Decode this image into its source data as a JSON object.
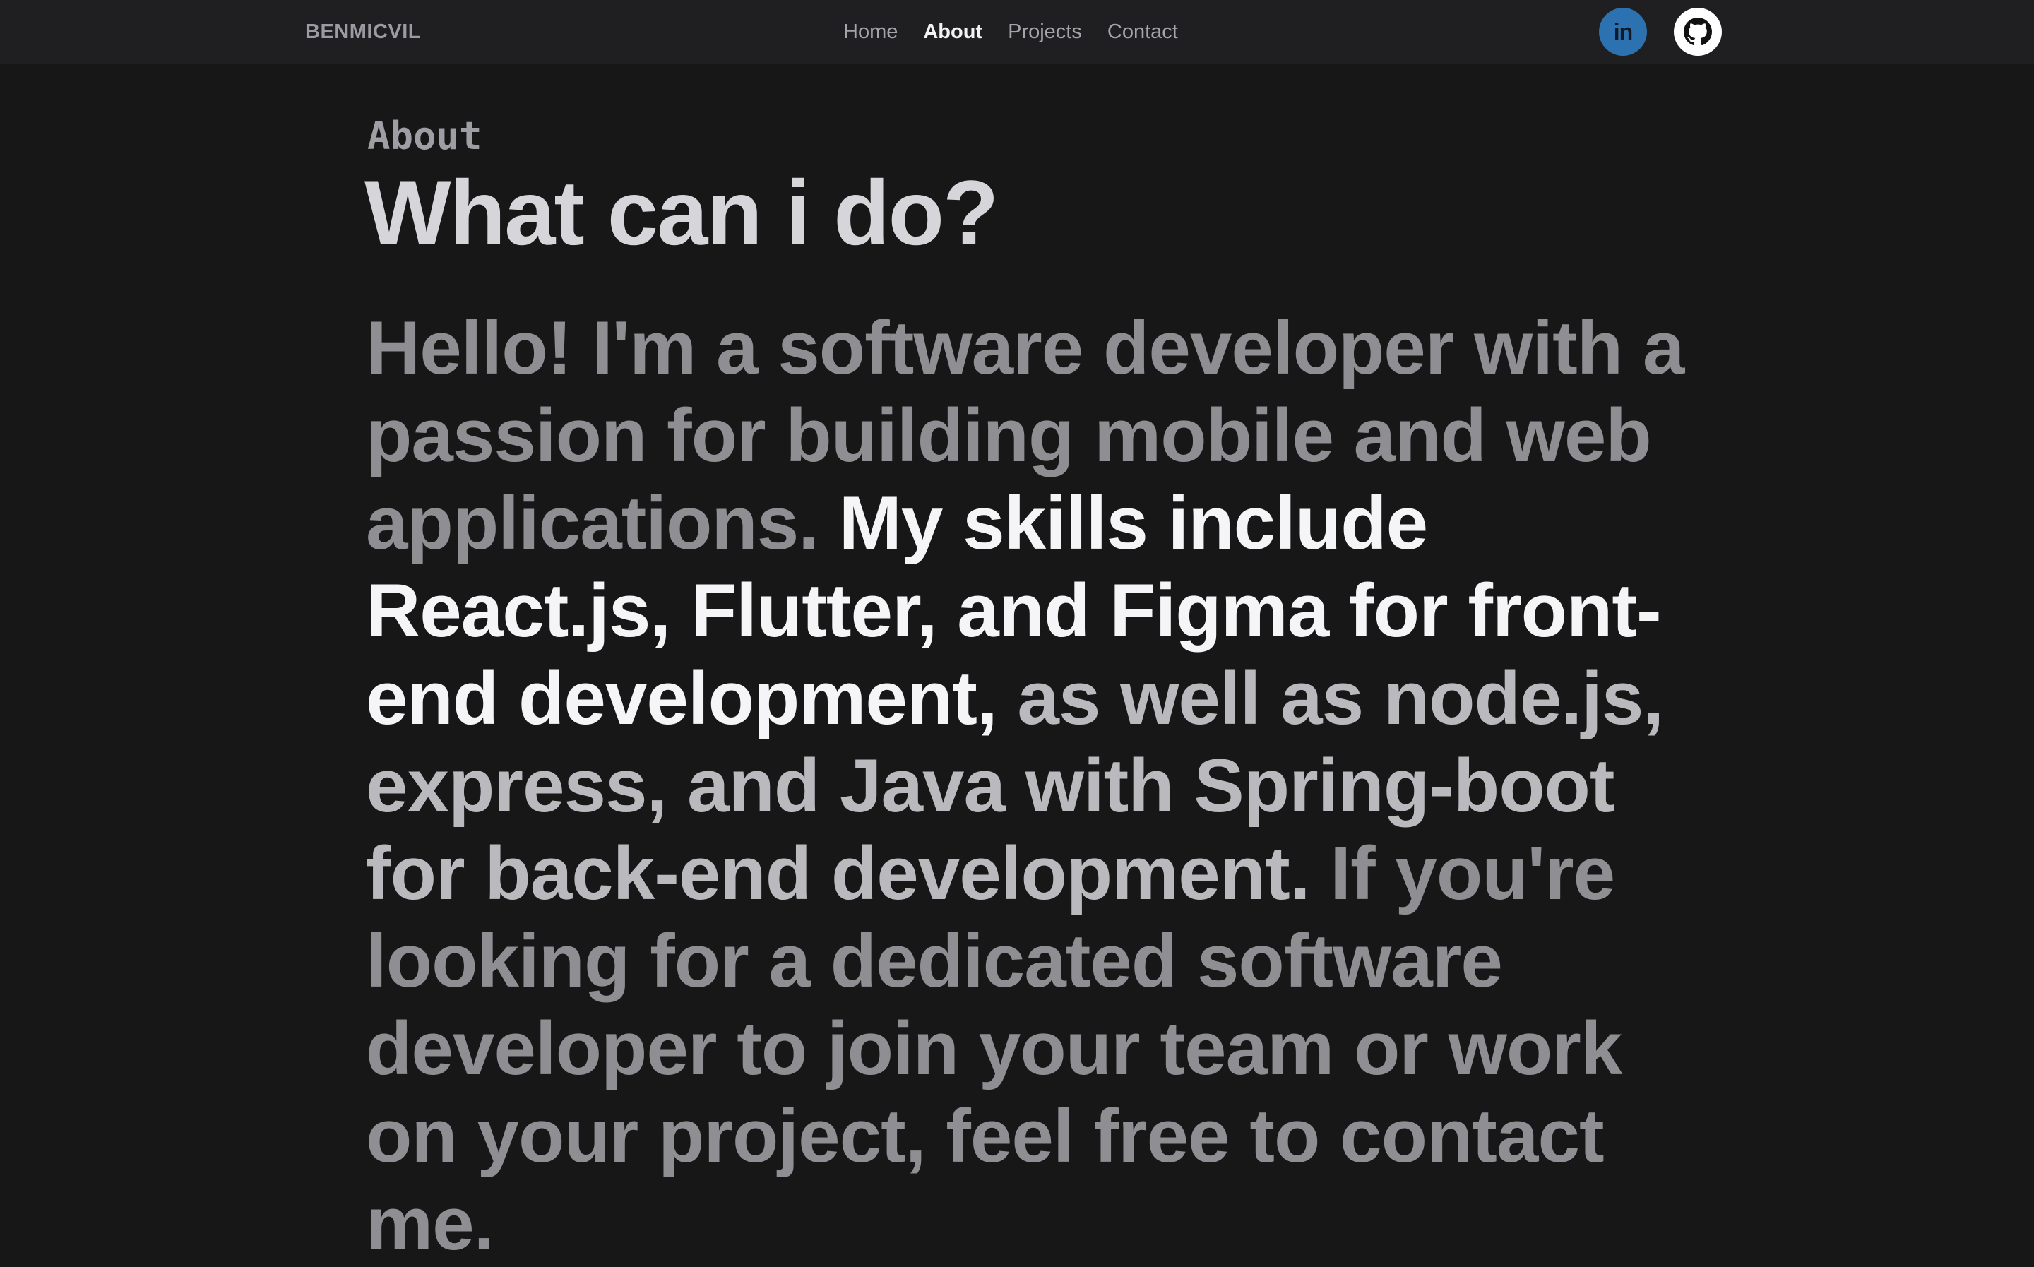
{
  "header": {
    "brand": "BENMICVIL",
    "nav": [
      {
        "label": "Home",
        "active": false
      },
      {
        "label": "About",
        "active": true
      },
      {
        "label": "Projects",
        "active": false
      },
      {
        "label": "Contact",
        "active": false
      }
    ],
    "social": [
      {
        "name": "linkedin-icon",
        "glyph": "in",
        "color": "#2c72b0"
      },
      {
        "name": "github-icon",
        "color": "#ffffff"
      }
    ]
  },
  "about": {
    "eyebrow": "About",
    "headline": "What can i do?",
    "bio": {
      "intro": "Hello! I'm a software developer with a passion for building mobile and web applications.",
      "frontend": "My skills include React.js, Flutter, and Figma for front-end development,",
      "backend_intro": "as well as node.js,",
      "backend": "express, and Java with Spring-boot for back-end development.",
      "outro": "If you're looking for a dedicated software developer to join your team or work on your project, feel free to contact me."
    }
  },
  "colors": {
    "background": "#171718",
    "header_background": "#1f1f21",
    "highlight": "#f5f5f7",
    "muted_text": "#8e8e93",
    "linkedin": "#2c72b0"
  }
}
